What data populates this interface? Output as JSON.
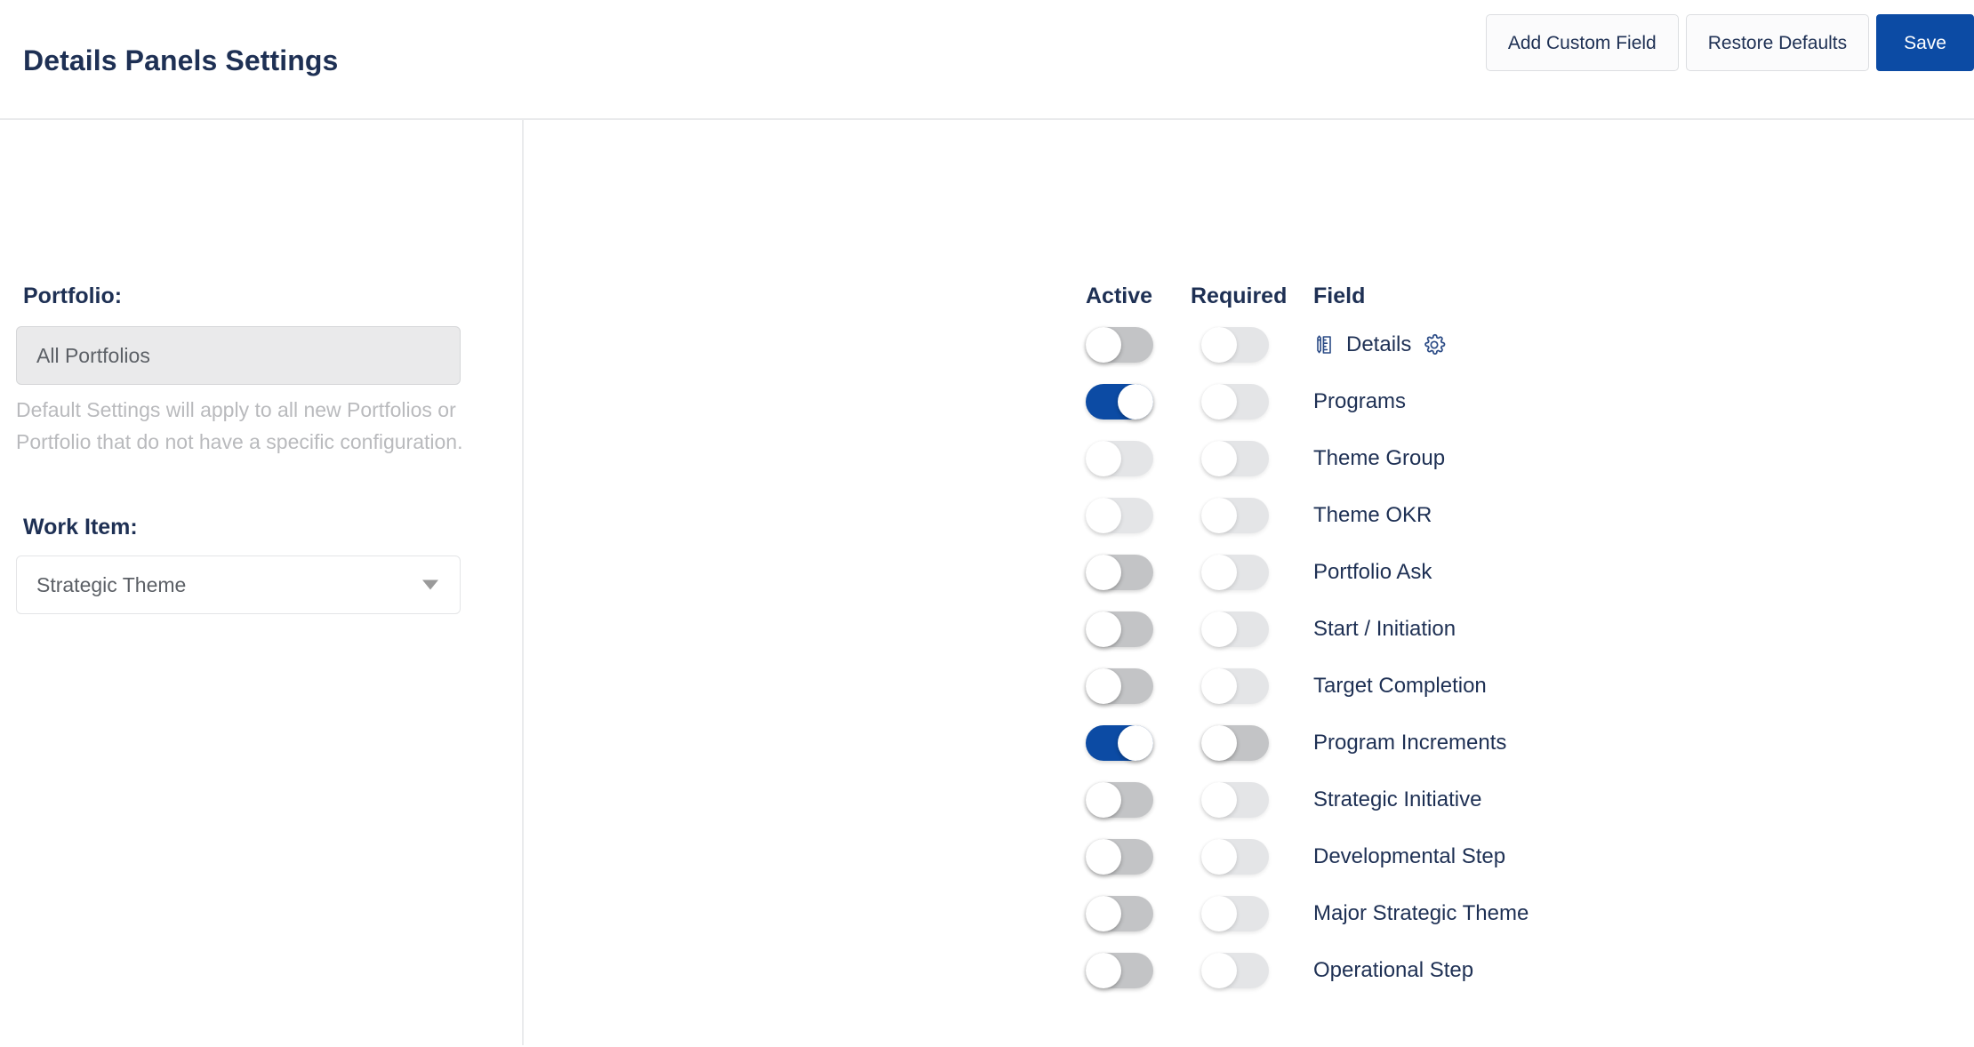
{
  "header": {
    "title": "Details Panels Settings",
    "buttons": [
      {
        "label": "Add Custom Field",
        "name": "add-custom-field-button",
        "style": "secondary"
      },
      {
        "label": "Restore Defaults",
        "name": "restore-defaults-button",
        "style": "secondary"
      },
      {
        "label": "Save",
        "name": "save-button",
        "style": "primary"
      }
    ]
  },
  "sidebar": {
    "portfolio_label": "Portfolio:",
    "portfolio_value": "All Portfolios",
    "portfolio_helper": "Default Settings will apply to all new Portfolios or Portfolio that do not have a specific configuration.",
    "work_item_label": "Work Item:",
    "work_item_value": "Strategic Theme",
    "work_item_caret": "chevron-down-icon"
  },
  "table": {
    "columns": {
      "active": "Active",
      "required": "Required",
      "field": "Field"
    },
    "rows": [
      {
        "label": "Details",
        "active": "off",
        "required": "off-light",
        "leading_icon": "details-panel-icon",
        "trailing_icon": "gear-icon"
      },
      {
        "label": "Programs",
        "active": "on",
        "required": "off-light",
        "leading_icon": null,
        "trailing_icon": null
      },
      {
        "label": "Theme Group",
        "active": "off-light",
        "required": "off-light",
        "leading_icon": null,
        "trailing_icon": null
      },
      {
        "label": "Theme OKR",
        "active": "off-light",
        "required": "off-light",
        "leading_icon": null,
        "trailing_icon": null
      },
      {
        "label": "Portfolio Ask",
        "active": "off",
        "required": "off-light",
        "leading_icon": null,
        "trailing_icon": null
      },
      {
        "label": "Start / Initiation",
        "active": "off",
        "required": "off-light",
        "leading_icon": null,
        "trailing_icon": null
      },
      {
        "label": "Target Completion",
        "active": "off",
        "required": "off-light",
        "leading_icon": null,
        "trailing_icon": null
      },
      {
        "label": "Program Increments",
        "active": "on",
        "required": "off",
        "leading_icon": null,
        "trailing_icon": null
      },
      {
        "label": "Strategic Initiative",
        "active": "off",
        "required": "off-light",
        "leading_icon": null,
        "trailing_icon": null
      },
      {
        "label": "Developmental Step",
        "active": "off",
        "required": "off-light",
        "leading_icon": null,
        "trailing_icon": null
      },
      {
        "label": "Major Strategic Theme",
        "active": "off",
        "required": "off-light",
        "leading_icon": null,
        "trailing_icon": null
      },
      {
        "label": "Operational Step",
        "active": "off",
        "required": "off-light",
        "leading_icon": null,
        "trailing_icon": null
      }
    ]
  },
  "colors": {
    "accent": "#0c4ba4",
    "text": "#1e3054",
    "muted": "#b9babd",
    "toggle_off": "#c3c4c6",
    "toggle_off_light": "#e4e5e7",
    "border": "#e9eaec"
  }
}
